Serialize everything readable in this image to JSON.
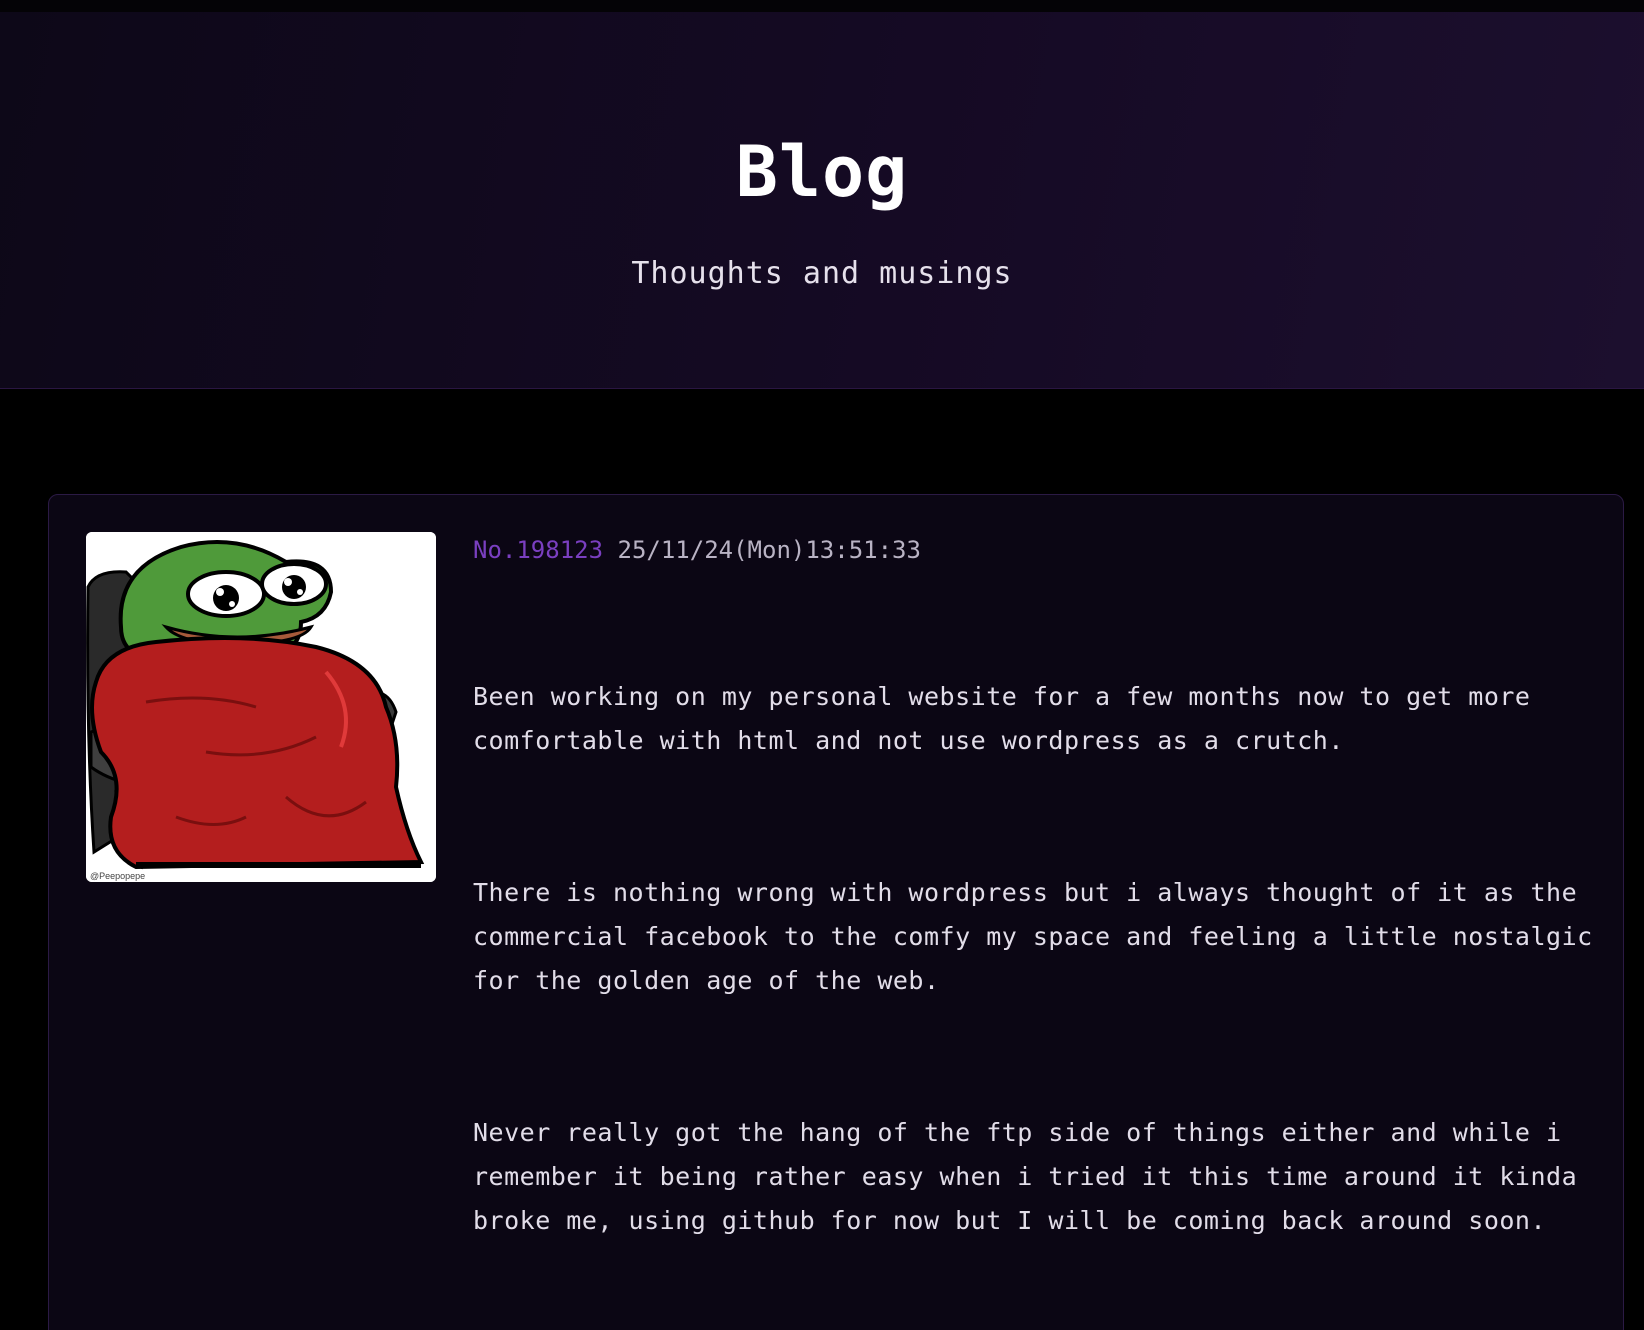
{
  "header": {
    "title": "Blog",
    "subtitle": "Thoughts and musings"
  },
  "post": {
    "number": "No.198123",
    "date": "25/11/24(Mon)13:51:33",
    "image": {
      "icon": "pepe-blanket-image",
      "credit": "@Peepopepe"
    },
    "paragraphs": [
      "Been working on my personal website for a few months now to get more comfortable with html and not use wordpress as a crutch.",
      "There is nothing wrong with wordpress but i always thought of it as the commercial facebook to the comfy my space and feeling a little nostalgic for the golden age of the web.",
      "Never really got the hang of the ftp side of things either and while i remember it being rather easy when i tried it this time around it kinda broke me, using github for now but I will be coming back around soon."
    ]
  },
  "colors": {
    "background": "#000000",
    "header": "#150a24",
    "card": "#0b0614",
    "accent": "#7a3fc0",
    "text": "#e2dde9"
  }
}
